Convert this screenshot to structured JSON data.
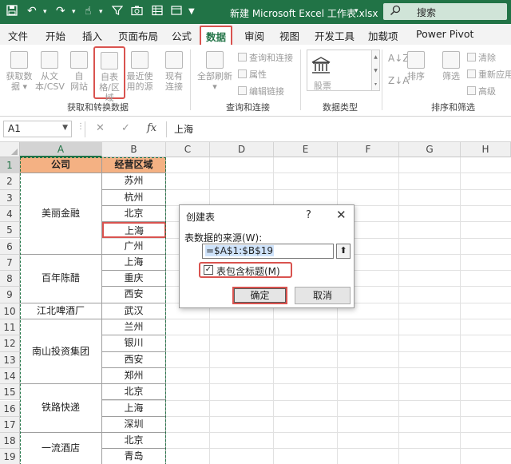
{
  "titlebar": {
    "title": "新建 Microsoft Excel 工作表.xlsx",
    "search_label": "搜索",
    "icons": [
      "save-icon",
      "undo-icon",
      "redo-icon",
      "touch-mode-icon",
      "filter-icon",
      "camera-icon",
      "table-icon",
      "window-icon",
      "customize-qat-icon",
      "search-icon"
    ]
  },
  "tabs": [
    "文件",
    "开始",
    "插入",
    "页面布局",
    "公式",
    "数据",
    "审阅",
    "视图",
    "开发工具",
    "加载项",
    "Power Pivot"
  ],
  "active_tab": "数据",
  "ribbon": {
    "groups": {
      "get_transform": {
        "label": "获取和转换数据",
        "buttons": [
          {
            "l1": "获取数",
            "l2": "据 ▾"
          },
          {
            "l1": "从文",
            "l2": "本/CSV"
          },
          {
            "l1": "自",
            "l2": "网站"
          },
          {
            "l1": "自表",
            "l2": "格/区域"
          },
          {
            "l1": "最近使",
            "l2": "用的源"
          },
          {
            "l1": "现有",
            "l2": "连接"
          }
        ]
      },
      "queries": {
        "label": "查询和连接",
        "refresh": {
          "l1": "全部刷新",
          "l2": "▾"
        },
        "items": [
          "查询和连接",
          "属性",
          "编辑链接"
        ]
      },
      "datatypes": {
        "label": "数据类型",
        "stock": "股票"
      },
      "sortfilter": {
        "label": "排序和筛选",
        "sort": "排序",
        "filter": "筛选",
        "items": [
          "清除",
          "重新应用",
          "高级"
        ]
      }
    }
  },
  "formula_bar": {
    "name_box": "A1",
    "cancel": "✕",
    "enter": "✓",
    "fx": "fx",
    "value": "上海"
  },
  "grid": {
    "columns": [
      "A",
      "B",
      "C",
      "D",
      "E",
      "F",
      "G",
      "H"
    ],
    "rows": [
      "1",
      "2",
      "3",
      "4",
      "5",
      "6",
      "7",
      "8",
      "9",
      "10",
      "11",
      "12",
      "13",
      "14",
      "15",
      "16",
      "17",
      "18",
      "19"
    ],
    "header": {
      "company": "公司",
      "region": "经营区域"
    },
    "groups": [
      {
        "company": "美丽金融",
        "regions": [
          "苏州",
          "杭州",
          "北京",
          "上海",
          "广州"
        ]
      },
      {
        "company": "百年陈醋",
        "regions": [
          "上海",
          "重庆",
          "西安"
        ]
      },
      {
        "company": "江北啤酒厂",
        "regions": [
          "武汉"
        ]
      },
      {
        "company": "南山投资集团",
        "regions": [
          "兰州",
          "银川",
          "西安",
          "郑州"
        ]
      },
      {
        "company": "铁路快递",
        "regions": [
          "北京",
          "上海",
          "深圳"
        ]
      },
      {
        "company": "一流酒店",
        "regions": [
          "北京",
          "青岛"
        ]
      }
    ]
  },
  "dialog": {
    "title": "创建表",
    "help": "?",
    "close": "✕",
    "source_label": "表数据的来源(W):",
    "source_value": "=$A$1:$B$19",
    "collapse": "⬆",
    "has_headers_checked": true,
    "check_mark": "✓",
    "has_headers_label": "表包含标题(M)",
    "ok": "确定",
    "cancel": "取消"
  },
  "colors": {
    "accent": "#217346",
    "highlight": "#d9534f",
    "header_fill": "#f4b183"
  }
}
